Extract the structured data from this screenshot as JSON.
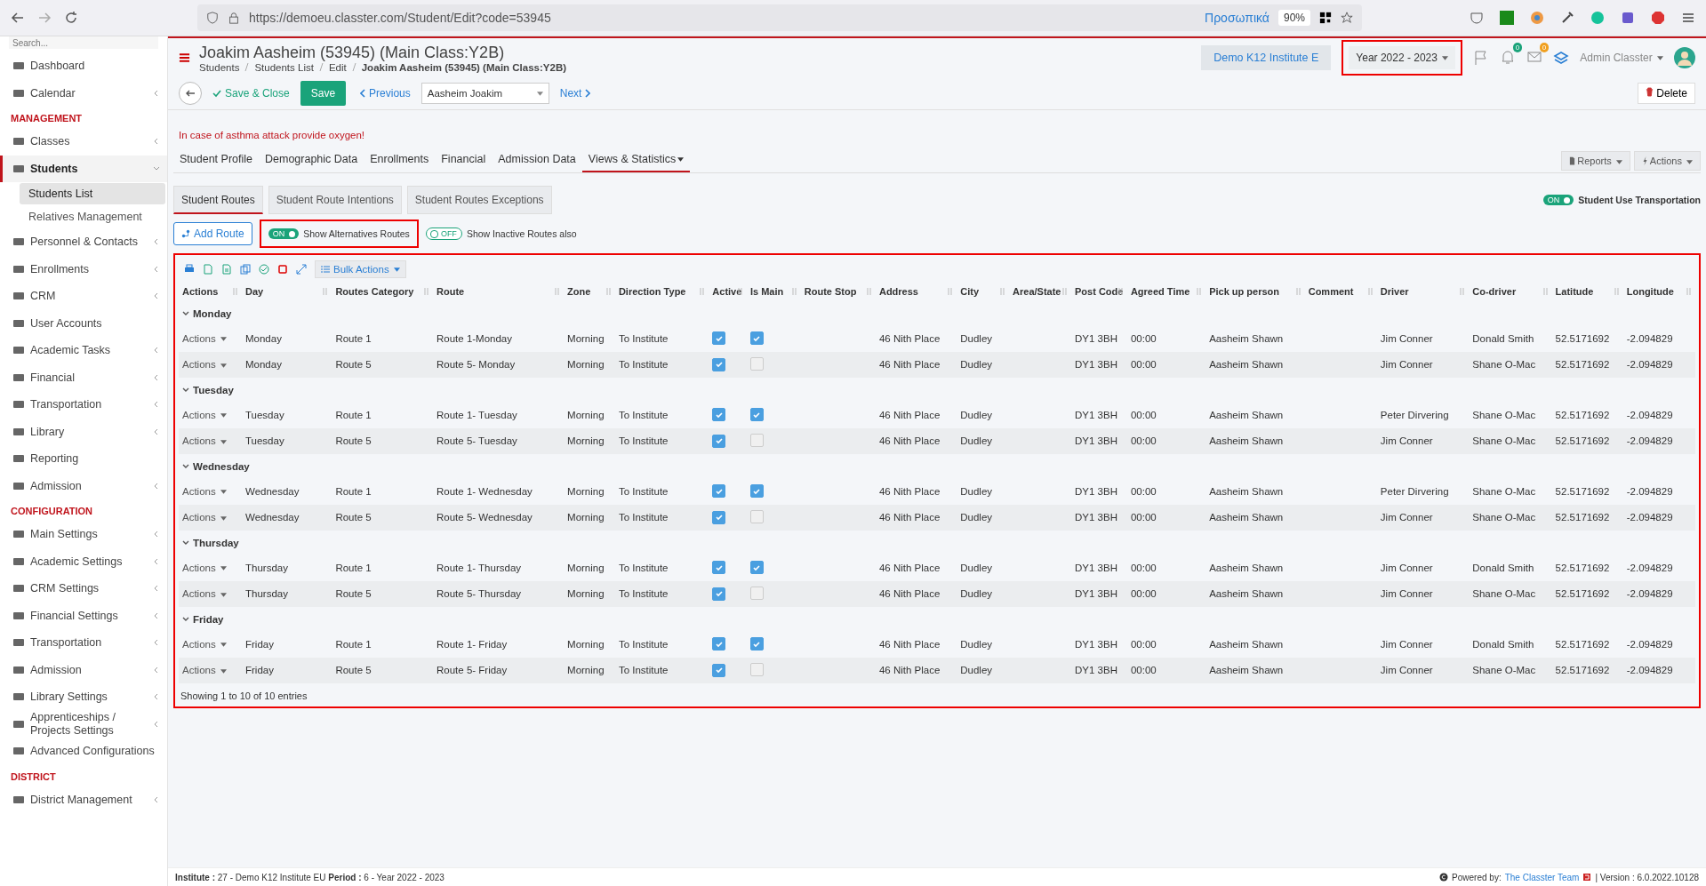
{
  "browser": {
    "url": "https://demoeu.classter.com/Student/Edit?code=53945",
    "profile": "Προσωπικά",
    "zoom": "90%"
  },
  "sidebar": {
    "search": {
      "placeholder": "Search..."
    },
    "sections": [
      {
        "items": [
          {
            "label": "Dashboard",
            "submenu": false,
            "expanded": false,
            "selected": false
          },
          {
            "label": "Calendar",
            "submenu": true,
            "expanded": false,
            "selected": false
          }
        ]
      },
      {
        "title": "MANAGEMENT",
        "items": [
          {
            "label": "Classes",
            "submenu": true,
            "expanded": false,
            "selected": false
          },
          {
            "label": "Students",
            "submenu": true,
            "expanded": true,
            "selected": true,
            "children": [
              {
                "label": "Students List",
                "selected": true
              },
              {
                "label": "Relatives Management",
                "selected": false
              }
            ]
          },
          {
            "label": "Personnel & Contacts",
            "submenu": true,
            "expanded": false,
            "selected": false
          },
          {
            "label": "Enrollments",
            "submenu": true,
            "expanded": false,
            "selected": false
          },
          {
            "label": "CRM",
            "submenu": true,
            "expanded": false,
            "selected": false
          },
          {
            "label": "User Accounts",
            "submenu": false,
            "expanded": false,
            "selected": false
          },
          {
            "label": "Academic Tasks",
            "submenu": true,
            "expanded": false,
            "selected": false
          },
          {
            "label": "Financial",
            "submenu": true,
            "expanded": false,
            "selected": false
          },
          {
            "label": "Transportation",
            "submenu": true,
            "expanded": false,
            "selected": false
          },
          {
            "label": "Library",
            "submenu": true,
            "expanded": false,
            "selected": false
          },
          {
            "label": "Reporting",
            "submenu": false,
            "expanded": false,
            "selected": false
          },
          {
            "label": "Admission",
            "submenu": true,
            "expanded": false,
            "selected": false
          }
        ]
      },
      {
        "title": "CONFIGURATION",
        "items": [
          {
            "label": "Main Settings",
            "submenu": true,
            "expanded": false,
            "selected": false
          },
          {
            "label": "Academic Settings",
            "submenu": true,
            "expanded": false,
            "selected": false
          },
          {
            "label": "CRM Settings",
            "submenu": true,
            "expanded": false,
            "selected": false
          },
          {
            "label": "Financial Settings",
            "submenu": true,
            "expanded": false,
            "selected": false
          },
          {
            "label": "Transportation",
            "submenu": true,
            "expanded": false,
            "selected": false
          },
          {
            "label": "Admission",
            "submenu": true,
            "expanded": false,
            "selected": false
          },
          {
            "label": "Library Settings",
            "submenu": true,
            "expanded": false,
            "selected": false
          },
          {
            "label": "Apprenticeships / Projects Settings",
            "submenu": true,
            "expanded": false,
            "selected": false
          },
          {
            "label": "Advanced Configurations",
            "submenu": false,
            "expanded": false,
            "selected": false
          }
        ]
      },
      {
        "title": "DISTRICT",
        "items": [
          {
            "label": "District Management",
            "submenu": true,
            "expanded": false,
            "selected": false
          }
        ]
      }
    ]
  },
  "header": {
    "title": "Joakim Aasheim (53945) (Main Class:Y2B)",
    "breadcrumb": [
      "Students",
      "Students List",
      "Edit",
      "Joakim Aasheim (53945) (Main Class:Y2B)"
    ],
    "institute": "Demo K12 Institute E",
    "year": "Year 2022 - 2023",
    "notifications": "0",
    "messages": "0",
    "user": "Admin Classter"
  },
  "toolbar": {
    "save_close": "Save & Close",
    "save": "Save",
    "previous": "Previous",
    "student_select": "Aasheim Joakim",
    "next": "Next",
    "delete": "Delete"
  },
  "alert": "In case of asthma attack provide oxygen!",
  "tabs": [
    {
      "label": "Student Profile",
      "selected": false
    },
    {
      "label": "Demographic Data",
      "selected": false
    },
    {
      "label": "Enrollments",
      "selected": false
    },
    {
      "label": "Financial",
      "selected": false
    },
    {
      "label": "Admission Data",
      "selected": false
    },
    {
      "label": "Views & Statistics",
      "selected": true
    }
  ],
  "tab_actions": [
    "Reports",
    "Actions"
  ],
  "subtabs": [
    {
      "label": "Student Routes",
      "selected": true
    },
    {
      "label": "Student Route Intentions",
      "selected": false
    },
    {
      "label": "Student Routes Exceptions",
      "selected": false
    }
  ],
  "add_route": "Add Route",
  "toggles": [
    {
      "label": "Show Alternatives Routes",
      "on": true,
      "state_text": "ON"
    },
    {
      "label": "Show Inactive Routes also",
      "on": false,
      "state_text": "OFF"
    }
  ],
  "transport_toggle": {
    "label": "Student Use Transportation",
    "on": true,
    "state_text": "ON"
  },
  "bulk_actions": "Bulk Actions",
  "columns": [
    "Actions",
    "Day",
    "Routes Category",
    "Route",
    "Zone",
    "Direction Type",
    "Active",
    "Is Main",
    "Route Stop",
    "Address",
    "City",
    "Area/State",
    "Post Code",
    "Agreed Time",
    "Pick up person",
    "Comment",
    "Driver",
    "Co-driver",
    "Latitude",
    "Longitude"
  ],
  "groups": [
    {
      "day": "Monday",
      "expanded": true,
      "rows": [
        {
          "actions": "Actions",
          "day": "Monday",
          "category": "Route 1",
          "route": "Route 1-Monday",
          "zone": "Morning",
          "direction": "To Institute",
          "active": true,
          "is_main": true,
          "address": "46 Nith Place",
          "city": "Dudley",
          "post_code": "DY1 3BH",
          "agreed_time": "00:00",
          "pickup": "Aasheim Shawn",
          "driver": "Jim Conner",
          "co_driver": "Donald Smith",
          "latitude": "52.5171692",
          "longitude": "-2.094829"
        },
        {
          "actions": "Actions",
          "day": "Monday",
          "category": "Route 5",
          "route": "Route 5- Monday",
          "zone": "Morning",
          "direction": "To Institute",
          "active": true,
          "is_main": false,
          "address": "46 Nith Place",
          "city": "Dudley",
          "post_code": "DY1 3BH",
          "agreed_time": "00:00",
          "pickup": "Aasheim Shawn",
          "driver": "Jim Conner",
          "co_driver": "Shane O-Mac",
          "latitude": "52.5171692",
          "longitude": "-2.094829"
        }
      ]
    },
    {
      "day": "Tuesday",
      "expanded": true,
      "rows": [
        {
          "actions": "Actions",
          "day": "Tuesday",
          "category": "Route 1",
          "route": "Route 1- Tuesday",
          "zone": "Morning",
          "direction": "To Institute",
          "active": true,
          "is_main": true,
          "address": "46 Nith Place",
          "city": "Dudley",
          "post_code": "DY1 3BH",
          "agreed_time": "00:00",
          "pickup": "Aasheim Shawn",
          "driver": "Peter Dirvering",
          "co_driver": "Shane O-Mac",
          "latitude": "52.5171692",
          "longitude": "-2.094829"
        },
        {
          "actions": "Actions",
          "day": "Tuesday",
          "category": "Route 5",
          "route": "Route 5- Tuesday",
          "zone": "Morning",
          "direction": "To Institute",
          "active": true,
          "is_main": false,
          "address": "46 Nith Place",
          "city": "Dudley",
          "post_code": "DY1 3BH",
          "agreed_time": "00:00",
          "pickup": "Aasheim Shawn",
          "driver": "Jim Conner",
          "co_driver": "Shane O-Mac",
          "latitude": "52.5171692",
          "longitude": "-2.094829"
        }
      ]
    },
    {
      "day": "Wednesday",
      "expanded": true,
      "rows": [
        {
          "actions": "Actions",
          "day": "Wednesday",
          "category": "Route 1",
          "route": "Route 1- Wednesday",
          "zone": "Morning",
          "direction": "To Institute",
          "active": true,
          "is_main": true,
          "address": "46 Nith Place",
          "city": "Dudley",
          "post_code": "DY1 3BH",
          "agreed_time": "00:00",
          "pickup": "Aasheim Shawn",
          "driver": "Peter Dirvering",
          "co_driver": "Shane O-Mac",
          "latitude": "52.5171692",
          "longitude": "-2.094829"
        },
        {
          "actions": "Actions",
          "day": "Wednesday",
          "category": "Route 5",
          "route": "Route 5- Wednesday",
          "zone": "Morning",
          "direction": "To Institute",
          "active": true,
          "is_main": false,
          "address": "46 Nith Place",
          "city": "Dudley",
          "post_code": "DY1 3BH",
          "agreed_time": "00:00",
          "pickup": "Aasheim Shawn",
          "driver": "Jim Conner",
          "co_driver": "Shane O-Mac",
          "latitude": "52.5171692",
          "longitude": "-2.094829"
        }
      ]
    },
    {
      "day": "Thursday",
      "expanded": true,
      "rows": [
        {
          "actions": "Actions",
          "day": "Thursday",
          "category": "Route 1",
          "route": "Route 1- Thursday",
          "zone": "Morning",
          "direction": "To Institute",
          "active": true,
          "is_main": true,
          "address": "46 Nith Place",
          "city": "Dudley",
          "post_code": "DY1 3BH",
          "agreed_time": "00:00",
          "pickup": "Aasheim Shawn",
          "driver": "Jim Conner",
          "co_driver": "Donald Smith",
          "latitude": "52.5171692",
          "longitude": "-2.094829"
        },
        {
          "actions": "Actions",
          "day": "Thursday",
          "category": "Route 5",
          "route": "Route 5- Thursday",
          "zone": "Morning",
          "direction": "To Institute",
          "active": true,
          "is_main": false,
          "address": "46 Nith Place",
          "city": "Dudley",
          "post_code": "DY1 3BH",
          "agreed_time": "00:00",
          "pickup": "Aasheim Shawn",
          "driver": "Jim Conner",
          "co_driver": "Shane O-Mac",
          "latitude": "52.5171692",
          "longitude": "-2.094829"
        }
      ]
    },
    {
      "day": "Friday",
      "expanded": true,
      "rows": [
        {
          "actions": "Actions",
          "day": "Friday",
          "category": "Route 1",
          "route": "Route 1- Friday",
          "zone": "Morning",
          "direction": "To Institute",
          "active": true,
          "is_main": true,
          "address": "46 Nith Place",
          "city": "Dudley",
          "post_code": "DY1 3BH",
          "agreed_time": "00:00",
          "pickup": "Aasheim Shawn",
          "driver": "Jim Conner",
          "co_driver": "Donald Smith",
          "latitude": "52.5171692",
          "longitude": "-2.094829"
        },
        {
          "actions": "Actions",
          "day": "Friday",
          "category": "Route 5",
          "route": "Route 5- Friday",
          "zone": "Morning",
          "direction": "To Institute",
          "active": true,
          "is_main": false,
          "address": "46 Nith Place",
          "city": "Dudley",
          "post_code": "DY1 3BH",
          "agreed_time": "00:00",
          "pickup": "Aasheim Shawn",
          "driver": "Jim Conner",
          "co_driver": "Shane O-Mac",
          "latitude": "52.5171692",
          "longitude": "-2.094829"
        }
      ]
    }
  ],
  "table_info": "Showing 1 to 10 of 10 entries",
  "footer": {
    "info": "**Institute :** 27 - Demo K12 Institute EU **Period :** 6 - Year 2022 - 2023",
    "powered": "Powered by:",
    "team": "The Classter Team",
    "version": "| Version : 6.0.2022.10128"
  }
}
